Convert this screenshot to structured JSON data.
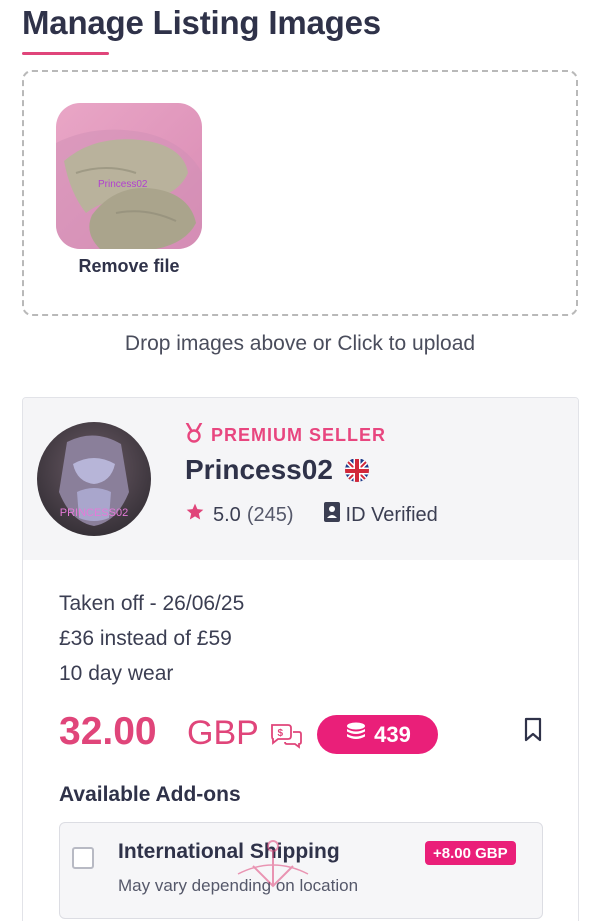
{
  "page": {
    "title": "Manage Listing Images"
  },
  "upload": {
    "thumbnail_caption": "Princess02",
    "remove_label": "Remove file",
    "drop_hint": "Drop images above or Click to upload"
  },
  "seller": {
    "badge": "PREMIUM SELLER",
    "name": "Princess02",
    "avatar_caption": "PRINCESS02",
    "rating": "5.0",
    "review_count": "(245)",
    "verified_label": "ID Verified",
    "country_flag_icon": "uk-flag-icon"
  },
  "listing": {
    "description_lines": [
      "Taken off - 26/06/25",
      "£36 instead of £59",
      "10 day wear"
    ],
    "price_amount": "32.00",
    "price_currency": "GBP",
    "token_price": "439"
  },
  "addons": {
    "title": "Available Add-ons",
    "items": [
      {
        "name": "International Shipping",
        "subtitle": "May vary depending on location",
        "price": "+8.00 GBP"
      }
    ]
  },
  "colors": {
    "accent": "#e0457a",
    "badge_pink": "#ea1f79",
    "text_dark": "#2f3249"
  }
}
